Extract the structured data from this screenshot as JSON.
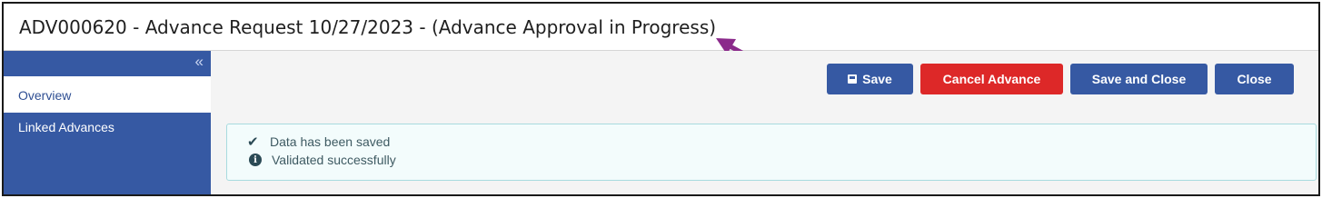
{
  "header": {
    "title": "ADV000620 - Advance Request 10/27/2023 - (Advance Approval in Progress)"
  },
  "annotation": {
    "arrow_color": "#8b2a8b"
  },
  "sidebar": {
    "collapse_icon": "double-chevron-left-icon",
    "collapse_glyph": "«",
    "items": [
      {
        "label": "Overview",
        "active": true
      },
      {
        "label": "Linked Advances",
        "active": false
      }
    ]
  },
  "toolbar": {
    "save_label": "Save",
    "save_icon": "floppy-disk-icon",
    "cancel_label": "Cancel Advance",
    "save_close_label": "Save and Close",
    "close_label": "Close"
  },
  "alert": {
    "messages": [
      {
        "icon": "checkmark-icon",
        "glyph": "✔",
        "text": "Data has been saved"
      },
      {
        "icon": "info-circle-icon",
        "glyph": "i",
        "text": "Validated successfully"
      }
    ]
  },
  "colors": {
    "primary": "#3659a3",
    "danger": "#dd2828",
    "alert_bg": "#f3fcfc",
    "alert_border": "#a8dbdf"
  }
}
